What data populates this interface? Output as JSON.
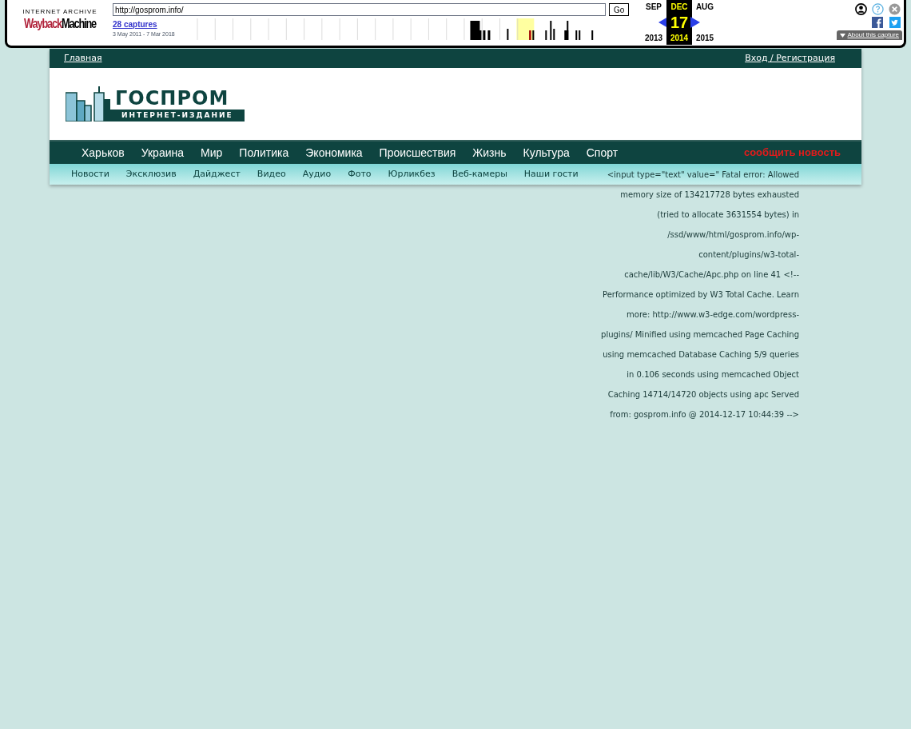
{
  "wayback": {
    "logo_top": "INTERNET ARCHIVE",
    "logo_left": "Wayback",
    "logo_right": "Machine",
    "url": "http://gosprom.info/",
    "go": "Go",
    "captures": "28 captures",
    "range": "3 May 2011 - 7 Mar 2018",
    "months": [
      {
        "month": "SEP",
        "year": "2013",
        "selected": false
      },
      {
        "month": "DEC",
        "day": "17",
        "year": "2014",
        "selected": true
      },
      {
        "month": "AUG",
        "year": "2015",
        "selected": false
      }
    ],
    "about": "About this capture"
  },
  "topbar": {
    "home": "Главная",
    "login": "Вход / Регистрация"
  },
  "logo": {
    "name": "ГОСПРОМ",
    "tagline": "ИНТЕРНЕТ-ИЗДАНИЕ"
  },
  "nav": [
    "Харьков",
    "Украина",
    "Мир",
    "Политика",
    "Экономика",
    "Происшествия",
    "Жизнь",
    "Культура",
    "Спорт"
  ],
  "report": "сообщить новость",
  "subnav": [
    "Новости",
    "Эксклюзив",
    "Дайджест",
    "Видео",
    "Аудио",
    "Фото",
    "Юрликбез",
    "Веб-камеры",
    "Наши гости"
  ],
  "error": "<input type=\"text\" value=\" Fatal error: Allowed memory size of 134217728 bytes exhausted (tried to allocate 3631554 bytes) in /ssd/www/html/gosprom.info/wp-content/plugins/w3-total-cache/lib/W3/Cache/Apc.php on line 41 <!-- Performance optimized by W3 Total Cache. Learn more: http://www.w3-edge.com/wordpress-plugins/ Minified using memcached Page Caching using memcached Database Caching 5/9 queries in 0.106 seconds using memcached Object Caching 14714/14720 objects using apc Served from: gosprom.info @ 2014-12-17 10:44:39 -->"
}
